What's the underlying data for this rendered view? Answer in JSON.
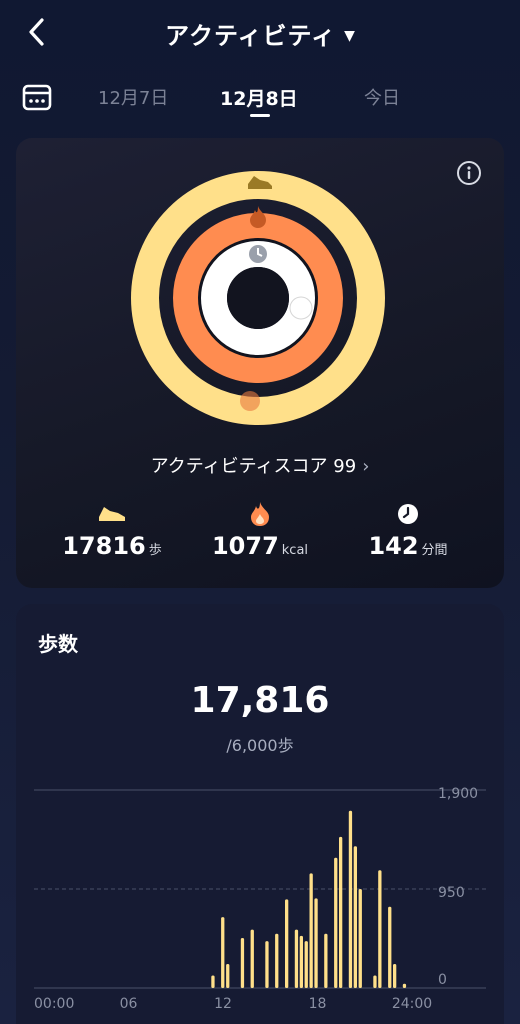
{
  "header": {
    "title": "アクティビティ",
    "icons": {
      "back": "chevron-left-icon",
      "dropdown": "caret-down-icon"
    }
  },
  "tabs": {
    "calendar_icon": "calendar-icon",
    "items": [
      {
        "label": "12月7日",
        "active": false
      },
      {
        "label": "12月8日",
        "active": true
      },
      {
        "label": "今日",
        "active": false
      }
    ]
  },
  "activity": {
    "score_label": "アクティビティスコア 99",
    "info_icon": "info-icon",
    "ring_colors": {
      "steps": "#ffe08a",
      "calories": "#ff8c50",
      "minutes": "#ffffff"
    },
    "stats": [
      {
        "icon": "shoe-icon",
        "value": "17816",
        "unit": "歩"
      },
      {
        "icon": "flame-icon",
        "value": "1077",
        "unit": "kcal"
      },
      {
        "icon": "clock-icon",
        "value": "142",
        "unit": "分間"
      }
    ]
  },
  "steps": {
    "title": "歩数",
    "value": "17,816",
    "goal": "/6,000歩"
  },
  "chart_data": {
    "type": "bar",
    "color": "#ffe08a",
    "x_tick_labels": [
      "00:00",
      "06",
      "12",
      "18",
      "24:00"
    ],
    "y_tick_labels": [
      "1,900",
      "950",
      "0"
    ],
    "ylim": [
      0,
      1900
    ],
    "bin_count": 72,
    "values": [
      0,
      0,
      0,
      0,
      0,
      0,
      0,
      0,
      0,
      0,
      0,
      0,
      0,
      0,
      0,
      0,
      0,
      0,
      0,
      0,
      0,
      0,
      0,
      0,
      0,
      0,
      0,
      0,
      0,
      0,
      0,
      0,
      0,
      0,
      0,
      0,
      120,
      0,
      680,
      230,
      0,
      0,
      480,
      0,
      560,
      0,
      0,
      450,
      0,
      520,
      0,
      850,
      0,
      560,
      500,
      450,
      1100,
      860,
      0,
      520,
      0,
      1250,
      1450,
      0,
      1700,
      1360,
      950,
      0,
      0,
      120,
      1130,
      0,
      780,
      230,
      0,
      40,
      0
    ]
  }
}
